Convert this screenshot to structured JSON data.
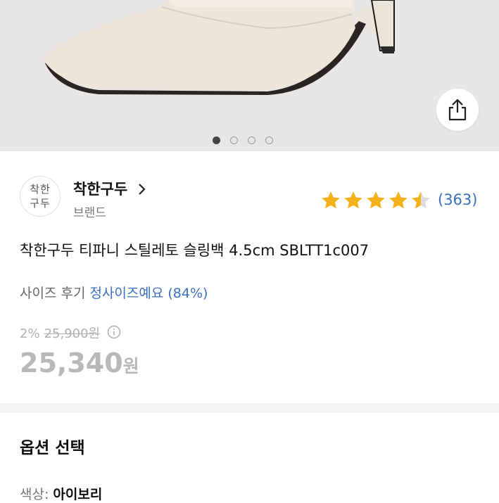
{
  "hero": {
    "dots_total": 4,
    "active_dot": 0
  },
  "brand": {
    "logo_text_1": "착한",
    "logo_text_2": "구두",
    "name": "착한구두",
    "sub": "브랜드"
  },
  "rating": {
    "stars": 4.5,
    "review_count": "(363)",
    "star_color": "#f6b21a"
  },
  "product": {
    "title": "착한구두 티파니 스틸레토 슬링백 4.5cm SBLTT1c007"
  },
  "size_review": {
    "label": "사이즈 후기",
    "value": "정사이즈예요 (84%)"
  },
  "price": {
    "discount": "2%",
    "original": "25,900원",
    "current": "25,340",
    "unit": "원"
  },
  "options": {
    "title": "옵션 선택",
    "color_label": "색상: ",
    "color_value": "아이보리"
  },
  "colors": {
    "link": "#3a6fc4",
    "accent": "#f6b21a"
  }
}
